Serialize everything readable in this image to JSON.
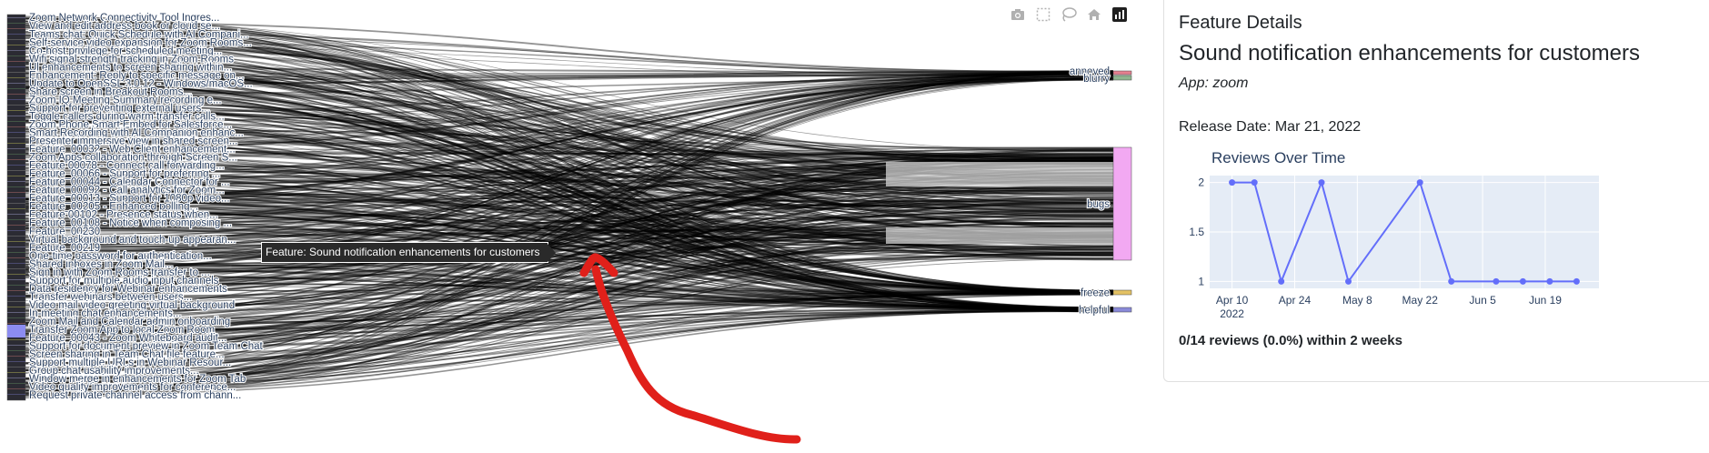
{
  "sankey": {
    "source_labels": [
      "Zoom Network Connectivity Tool Ingres...",
      "View and edit address book or cloud se...",
      "Teams chat: Quick Schedule with AI Compani...",
      "Self-service video expansion for Zoom Rooms...",
      "Co-host privilege for scheduled meeting...",
      "Wifi signal strength tracking in Zoom Rooms",
      "Ul enhancements to screen sharing within...",
      "Enhancement: Reply to specific message on...",
      "Update to OpenSSL 3.0.12 - Windows/macOS...",
      "Share screen in Breakout Rooms...",
      "Zoom IQ Meeting Summary recording e...",
      "Support for preventing external users...",
      "Toggle callers during warm transfer calls...",
      "Zoom Phone Smart Embed for Salesforce...",
      "Smart Recording with AI Companion enhanc...",
      "Presenter immersive view in shared screen...",
      "Feature_00032 - Web Client enhancement...",
      "Zoom Apps collaboration through Screen S...",
      "Feature 00078 - Connect call forwarding...",
      "Feature_00066 - Support for preferring ...",
      "Feature_00044 - Calendar Connector for ...",
      "Feature_00092 - Call analytics for Zoom...",
      "Feature_00013 - Support for 1080p video...",
      "Feature_00205 - Enhanced polling...",
      "Feature 00102 - Presence status when...",
      "Feature_00108 - Notice when composing ...",
      "Feature_00230",
      "Virtual background and touch-up appearan...",
      "Feature_00219",
      "One-time password for authentication...",
      "Shared inboxes in Zoom Mail...",
      "Sign in with Zoom Rooms transfer to ...",
      "Support for multiple audio input channels",
      "Data residency for Webinar enhancements",
      "Transfer webinars between users...",
      "Video mail video greeting virtual background",
      "In-meeting chat enhancements...",
      "Zoom Mail and Calendar admin onboarding",
      "Transfer Zoom App to local Zoom Room",
      "Feature_00043 - Zoom Whiteboard audit...",
      "Support for document preview in Zoom Team Chat",
      "Screen sharing in Team Chat file feature...",
      "Support multiple URLs in Webinar Resour...",
      "Group chat usability improvements...",
      "Window merge in enhancements for Zoom Tab",
      "Video quality improvements for conference...",
      "Request private channel access from chann..."
    ],
    "target_labels": [
      "annoyed",
      "blurry",
      "bugs",
      "freeze",
      "helpful"
    ],
    "target_colors": [
      "#e5808f",
      "#8fb58f",
      "#f2a9f2",
      "#e3c164",
      "#8a8ad8"
    ],
    "tooltip": "Feature: Sound notification enhancements for customers"
  },
  "modebar": {
    "icons": [
      "camera-icon",
      "box-select-icon",
      "lasso-icon",
      "home-icon",
      "plotly-logo-icon"
    ]
  },
  "panel": {
    "heading": "Feature Details",
    "title": "Sound notification enhancements for customers",
    "app": "App: zoom",
    "release": "Release Date: Mar 21, 2022",
    "summary": "0/14 reviews (0.0%) within 2 weeks"
  },
  "chart_data": {
    "type": "line",
    "title": "Reviews Over Time",
    "x": [
      "2022-04-10",
      "2022-04-15",
      "2022-04-21",
      "2022-04-30",
      "2022-05-06",
      "2022-05-22",
      "2022-05-29",
      "2022-06-08",
      "2022-06-14",
      "2022-06-20",
      "2022-06-26"
    ],
    "y": [
      2,
      2,
      1,
      2,
      1,
      2,
      1,
      1,
      1,
      1,
      1
    ],
    "x_ticks": [
      "Apr 10",
      "Apr 24",
      "May 8",
      "May 22",
      "Jun 5",
      "Jun 19"
    ],
    "x_tick_dates": [
      "2022-04-10",
      "2022-04-24",
      "2022-05-08",
      "2022-05-22",
      "2022-06-05",
      "2022-06-19"
    ],
    "x_year_label": "2022",
    "y_ticks": [
      "1",
      "1.5",
      "2"
    ],
    "ylim": [
      0.93,
      2.07
    ],
    "xlim": [
      "2022-04-05",
      "2022-07-01"
    ],
    "line_color": "#636efa",
    "plot_bg": "#e5ecf6",
    "grid": true
  }
}
